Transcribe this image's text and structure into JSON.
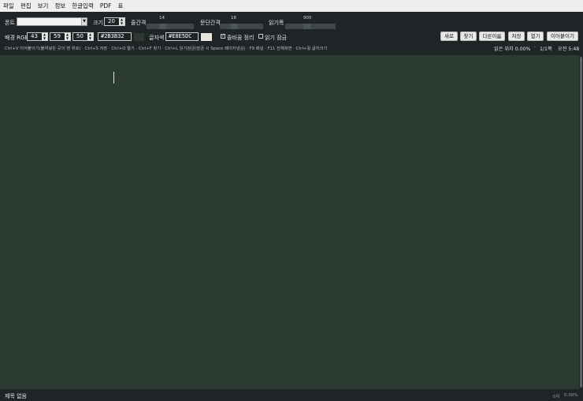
{
  "menu": [
    "파일",
    "편집",
    "보기",
    "정보",
    "한글입력",
    "PDF",
    "표"
  ],
  "toolbar": {
    "font_label": "폰트",
    "font_value": "",
    "size_label": "크기",
    "size_value": "20",
    "line_spacing_label": "줄간격",
    "line_spacing_value": "14",
    "para_spacing_label": "문단간격",
    "para_spacing_value": "18",
    "read_width_label": "읽기폭",
    "read_width_value": "900",
    "bg_rgb_label": "배경 RGB",
    "bg_r": "43",
    "bg_g": "59",
    "bg_b": "50",
    "bg_hex": "#2B3B32",
    "text_color_label": "글자색",
    "text_hex": "#E8E5DC",
    "auto_wrap_label": "줄바꿈 정리",
    "auto_wrap_checked": "✓",
    "read_lock_label": "읽기 잠금",
    "buttons": {
      "new": "새로",
      "find": "찾기",
      "save_as": "다른이름",
      "save": "저장",
      "open": "열기",
      "continue": "이어붙이기"
    },
    "shortcuts": "Ctrl+V 이어붙이기(붙여넣은 곳이 맨 위로) · Ctrl+S 저장 · Ctrl+O 열기 · Ctrl+F 찾기 · Ctrl+L 읽기잠금(잠금 시 Space 페이지넘김) · F9 패널 · F11 전체화면 · Ctrl+휠 글자크기",
    "read_position": "읽은 위치 0.00%",
    "sep": "·",
    "page": "1/1쪽",
    "clock": "오전 5:48"
  },
  "bottom": {
    "title": "제목 없음",
    "chars": "0자",
    "percent": "0.00%"
  },
  "colors": {
    "background": "#2B3B32",
    "text": "#E8E5DC"
  },
  "icons": {
    "combo": "chevron-down-icon",
    "spin": "up-down-arrows-icon",
    "check": "check-icon"
  }
}
